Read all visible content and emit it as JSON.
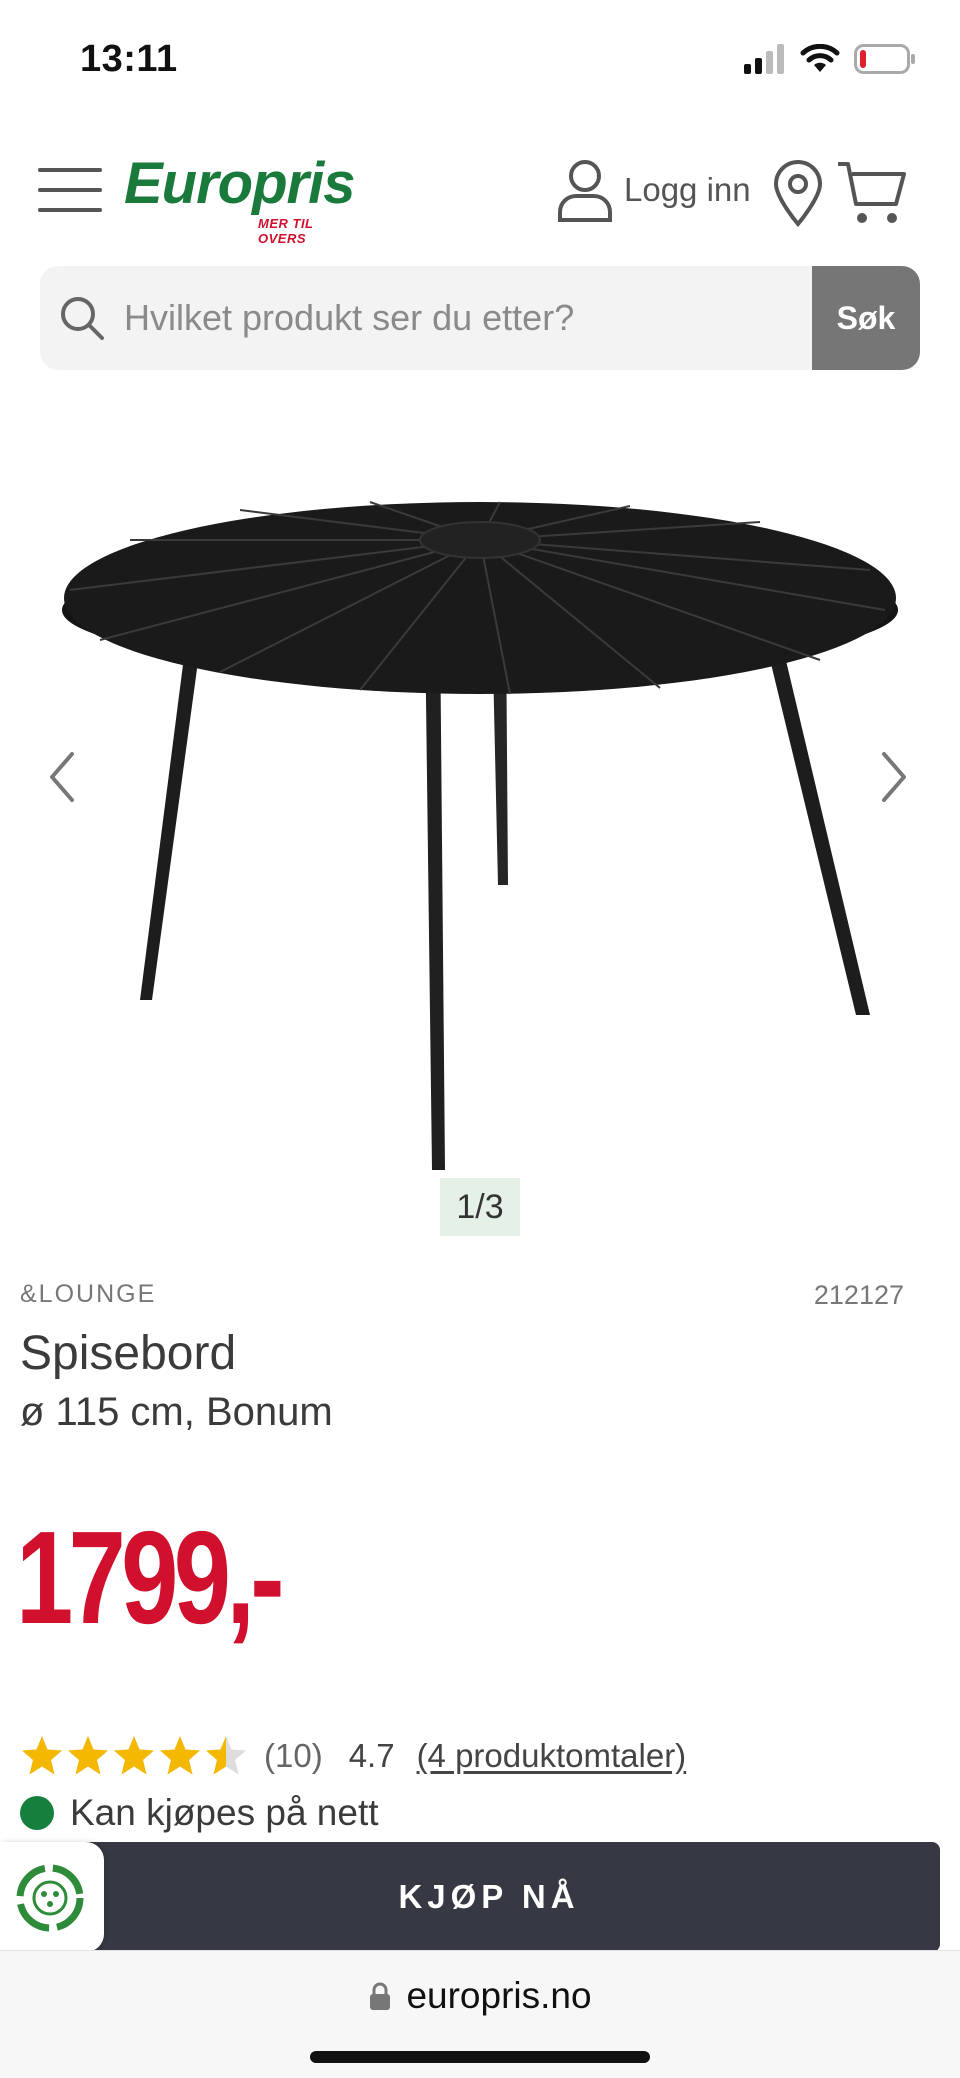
{
  "status_bar": {
    "time": "13:11"
  },
  "header": {
    "logo_text": "Europris",
    "logo_tagline": "MER TIL OVERS",
    "login_label": "Logg inn"
  },
  "search": {
    "placeholder": "Hvilket produkt ser du etter?",
    "button_label": "Søk"
  },
  "gallery": {
    "counter": "1/3"
  },
  "product": {
    "brand": "&LOUNGE",
    "sku": "212127",
    "title": "Spisebord",
    "subtitle": "ø 115 cm, Bonum",
    "price": "1799,-",
    "rating": {
      "stars": 4.5,
      "max_stars": 5,
      "count_label": "(10)",
      "average": "4.7",
      "reviews_link": "(4 produktomtaler)"
    },
    "availability": "Kan kjøpes på nett"
  },
  "buy_bar": {
    "button_label": "KJØP NÅ"
  },
  "browser": {
    "url": "europris.no"
  },
  "colors": {
    "brand_green": "#1a7a3c",
    "price_red": "#d0102c",
    "star_yellow": "#f5b800",
    "availability_green": "#15803d",
    "buy_button": "#363843"
  }
}
